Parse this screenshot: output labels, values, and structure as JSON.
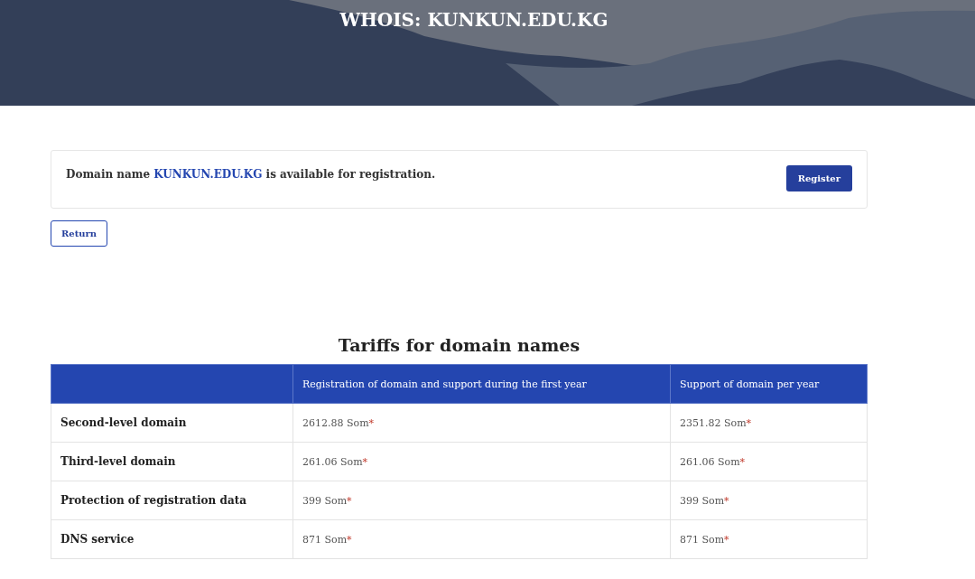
{
  "header": {
    "title": "WHOIS: KUNKUN.EDU.KG"
  },
  "notice": {
    "text_before": "Domain name ",
    "domain_link": "KUNKUN.EDU.KG",
    "text_after": " is available for registration.",
    "button": "Register"
  },
  "return_button": "Return",
  "tariffs": {
    "title": "Tariffs for domain names",
    "columns": [
      "",
      "Registration of domain and support during the first year",
      "Support of domain per year"
    ],
    "rows": [
      {
        "cells": [
          {
            "kind": "label",
            "text": "Second-level domain"
          },
          {
            "kind": "price",
            "text": "2612.88 Som",
            "mark": "*"
          },
          {
            "kind": "price",
            "text": "2351.82 Som",
            "mark": "*"
          }
        ]
      },
      {
        "cells": [
          {
            "kind": "label",
            "text": "Third-level domain"
          },
          {
            "kind": "price",
            "text": "261.06 Som",
            "mark": "*"
          },
          {
            "kind": "price",
            "text": "261.06 Som",
            "mark": "*"
          }
        ]
      },
      {
        "cells": [
          {
            "kind": "label",
            "text": "Protection of registration data"
          },
          {
            "kind": "price",
            "text": "399 Som",
            "mark": "*"
          },
          {
            "kind": "price",
            "text": "399 Som",
            "mark": "*"
          }
        ]
      },
      {
        "cells": [
          {
            "kind": "label",
            "text": "DNS service"
          },
          {
            "kind": "price",
            "text": "871 Som",
            "mark": "*"
          },
          {
            "kind": "price",
            "text": "871 Som",
            "mark": "*"
          }
        ]
      }
    ]
  }
}
